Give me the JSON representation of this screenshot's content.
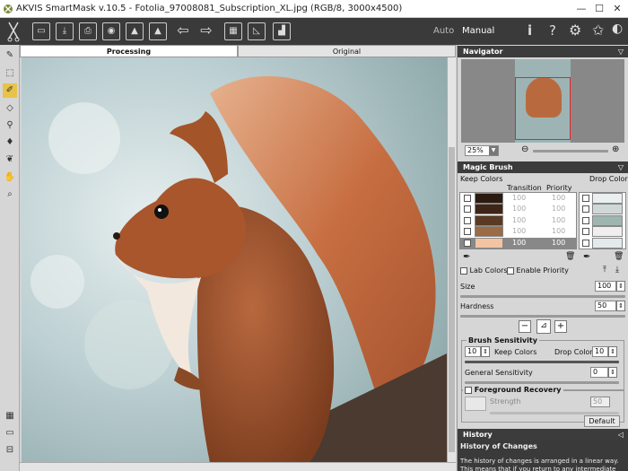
{
  "window": {
    "title": "AKVIS SmartMask v.10.5 - Fotolia_97008081_Subscription_XL.jpg (RGB/8, 3000x4500)",
    "minimize": "—",
    "maximize": "☐",
    "close": "✕"
  },
  "toolbar": {
    "icons": [
      "scissors-logo-icon",
      "open-icon",
      "save-icon",
      "print-icon",
      "share-icon",
      "batch-icon",
      "batch-alt-icon",
      "undo-icon",
      "redo-icon",
      "background-icon",
      "curves-icon",
      "histogram-icon"
    ],
    "mode_auto": "Auto",
    "mode_manual": "Manual",
    "right_icons": [
      "info-icon",
      "help-icon",
      "settings-icon",
      "star-icon"
    ]
  },
  "left_tools": [
    "magic-brush-icon",
    "selection-icon",
    "magic-brush-active-icon",
    "eraser-icon",
    "dropper-icon",
    "bucket-icon",
    "chroma-icon",
    "hand-icon",
    "zoom-icon",
    "checker-icon",
    "frame-icon",
    "split-icon"
  ],
  "tabs": {
    "processing": "Processing",
    "original": "Original"
  },
  "navigator": {
    "title": "Navigator",
    "zoom": "25%"
  },
  "magic_brush": {
    "title": "Magic Brush",
    "keep_colors": "Keep Colors",
    "drop_colors": "Drop Colors",
    "transition": "Transition",
    "priority": "Priority",
    "keep_rows": [
      {
        "color": "#2b1a10",
        "transition": "100",
        "priority": "100"
      },
      {
        "color": "#3d2617",
        "transition": "100",
        "priority": "100"
      },
      {
        "color": "#5a3a22",
        "transition": "100",
        "priority": "100"
      },
      {
        "color": "#9a6b45",
        "transition": "100",
        "priority": "100"
      },
      {
        "color": "#f2c4a4",
        "transition": "100",
        "priority": "100"
      }
    ],
    "drop_colors_list": [
      "#eaf0ef",
      "#cfd8d6",
      "#9fb5b0",
      "#f1eef0",
      "#e4eaea"
    ],
    "lab_colors": "Lab Colors",
    "enable_priority": "Enable Priority",
    "size_label": "Size",
    "size_value": "100",
    "hardness_label": "Hardness",
    "hardness_value": "50",
    "brush_sensitivity": "Brush Sensitivity",
    "keep_value": "10",
    "keep_label": "Keep Colors",
    "drop_label": "Drop Colors",
    "drop_value": "10",
    "general_label": "General Sensitivity",
    "general_value": "0",
    "foreground_recovery": "Foreground Recovery",
    "strength_label": "Strength",
    "strength_value": "50",
    "default_button": "Default"
  },
  "history": {
    "title": "History",
    "heading": "History of Changes",
    "text": "The history of changes is arranged in a linear way. This means that if you return to any intermediate"
  }
}
